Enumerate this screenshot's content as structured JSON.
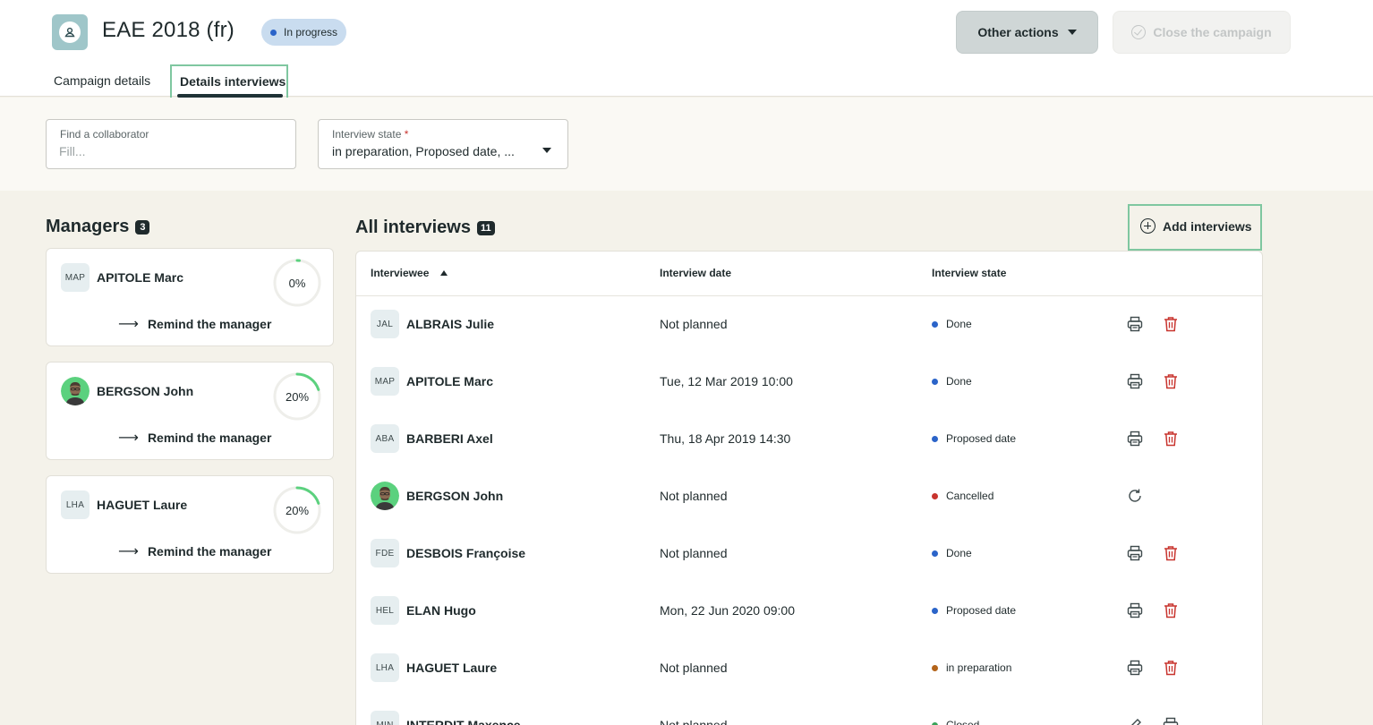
{
  "header": {
    "title": "EAE 2018 (fr)",
    "status": "In progress",
    "other_actions_label": "Other actions",
    "close_label": "Close the campaign",
    "tabs": [
      {
        "label": "Campaign details"
      },
      {
        "label": "Details interviews"
      }
    ]
  },
  "filters": {
    "collaborator": {
      "label": "Find a collaborator",
      "placeholder": "Fill..."
    },
    "state": {
      "label": "Interview state",
      "required_mark": "*",
      "value": "in preparation, Proposed date, ..."
    }
  },
  "managers": {
    "title": "Managers",
    "count": "3",
    "remind_label": "Remind the manager",
    "items": [
      {
        "initials": "MAP",
        "name": "APITOLE Marc",
        "progress_label": "0%",
        "progress": 0.0,
        "photo": false
      },
      {
        "initials": "",
        "name": "BERGSON John",
        "progress_label": "20%",
        "progress": 0.2,
        "photo": true
      },
      {
        "initials": "LHA",
        "name": "HAGUET Laure",
        "progress_label": "20%",
        "progress": 0.2,
        "photo": false
      }
    ]
  },
  "interviews": {
    "title": "All interviews",
    "count": "11",
    "add_label": "Add interviews",
    "columns": {
      "interviewee": "Interviewee",
      "date": "Interview date",
      "state": "Interview state"
    },
    "rows": [
      {
        "initials": "JAL",
        "name": "ALBRAIS Julie",
        "date": "Not planned",
        "state": "Done",
        "state_color": "#2b64c9",
        "actions": [
          "print-icon",
          "trash-icon"
        ],
        "photo": false
      },
      {
        "initials": "MAP",
        "name": "APITOLE Marc",
        "date": "Tue, 12 Mar 2019 10:00",
        "state": "Done",
        "state_color": "#2b64c9",
        "actions": [
          "print-icon",
          "trash-icon"
        ],
        "photo": false
      },
      {
        "initials": "ABA",
        "name": "BARBERI Axel",
        "date": "Thu, 18 Apr 2019 14:30",
        "state": "Proposed date",
        "state_color": "#2b64c9",
        "actions": [
          "print-icon",
          "trash-icon"
        ],
        "photo": false
      },
      {
        "initials": "",
        "name": "BERGSON John",
        "date": "Not planned",
        "state": "Cancelled",
        "state_color": "#c8342e",
        "actions": [
          "refresh-icon"
        ],
        "photo": true
      },
      {
        "initials": "FDE",
        "name": "DESBOIS Françoise",
        "date": "Not planned",
        "state": "Done",
        "state_color": "#2b64c9",
        "actions": [
          "print-icon",
          "trash-icon"
        ],
        "photo": false
      },
      {
        "initials": "HEL",
        "name": "ELAN Hugo",
        "date": "Mon, 22 Jun 2020 09:00",
        "state": "Proposed date",
        "state_color": "#2b64c9",
        "actions": [
          "print-icon",
          "trash-icon"
        ],
        "photo": false
      },
      {
        "initials": "LHA",
        "name": "HAGUET Laure",
        "date": "Not planned",
        "state": "in preparation",
        "state_color": "#b3641a",
        "actions": [
          "print-icon",
          "trash-icon"
        ],
        "photo": false
      },
      {
        "initials": "MIN",
        "name": "INTERDIT Maxence",
        "date": "Not planned",
        "state": "Closed",
        "state_color": "#3aa35a",
        "actions": [
          "edit-icon",
          "print-icon"
        ],
        "photo": false
      }
    ]
  },
  "colors": {
    "accent_green": "#7fc7a0",
    "progress_green": "#5bd17e",
    "trash_red": "#c8342e"
  }
}
